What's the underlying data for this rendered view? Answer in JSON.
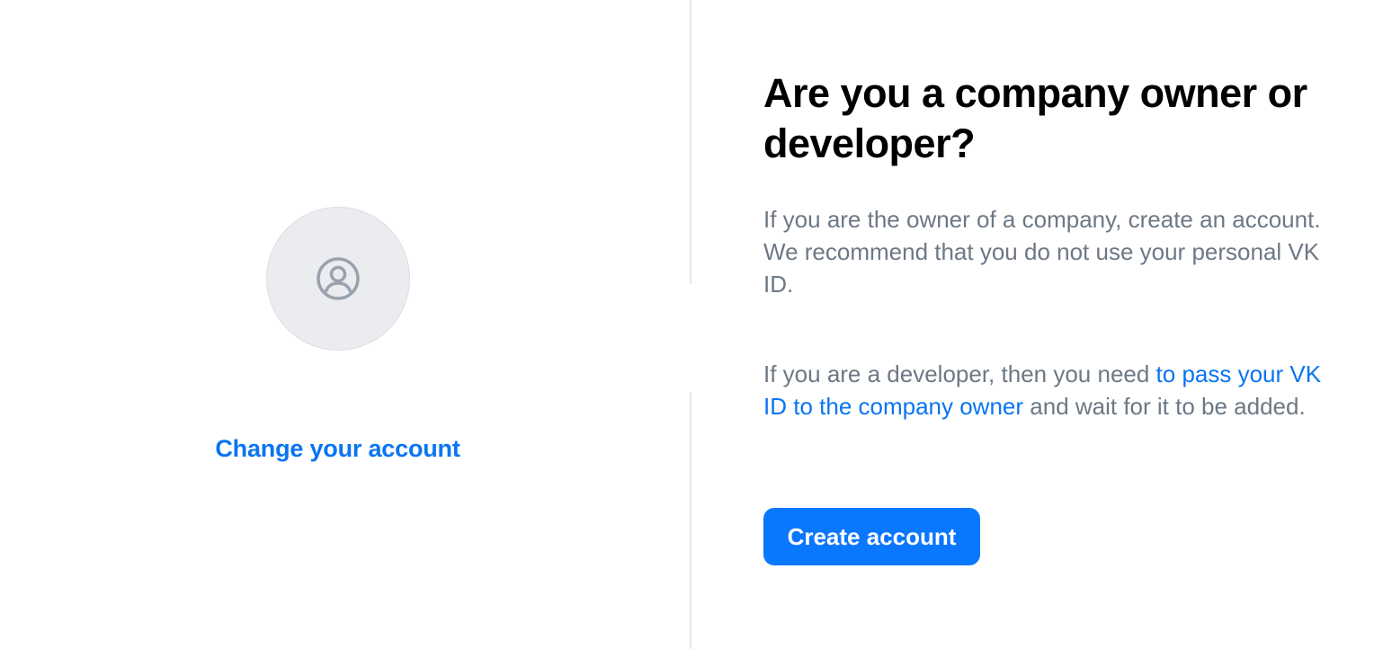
{
  "left": {
    "avatar_icon": "user-circle-icon",
    "change_account_label": "Change your account"
  },
  "right": {
    "heading": "Are you a company owner or developer?",
    "owner_text": "If you are the owner of a company, create an account. We recommend that you do not use your personal VK ID.",
    "developer_text_before": "If you are a developer, then you need ",
    "developer_link": "to pass your VK ID to the company owner",
    "developer_text_after": " and wait for it to be added.",
    "create_button_label": "Create account"
  },
  "colors": {
    "accent": "#0a74f2",
    "button": "#0a77ff",
    "secondary_text": "#6d7885",
    "avatar_bg": "#ebecf0",
    "divider": "#e6e7ea"
  }
}
